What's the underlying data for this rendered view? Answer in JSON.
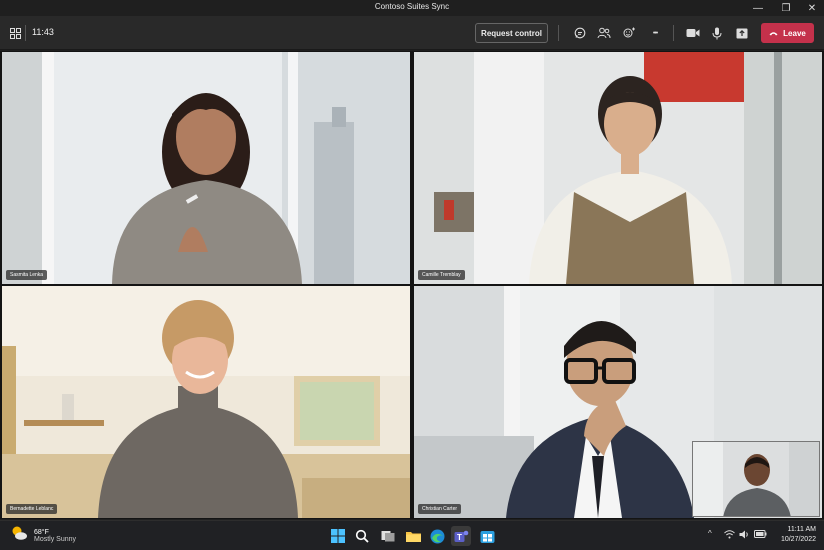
{
  "window": {
    "title": "Contoso Suites Sync",
    "minimize_glyph": "—",
    "restore_glyph": "❐",
    "close_glyph": "✕"
  },
  "toolbar": {
    "time": "11:43",
    "request_control_label": "Request control",
    "leave_label": "Leave",
    "more_glyph": "•••",
    "leave_color": "#c4314b"
  },
  "participants": [
    {
      "name": "Sasmita Lenka"
    },
    {
      "name": "Camille Tremblay"
    },
    {
      "name": "Bernadette Leblanc"
    },
    {
      "name": "Christian Carter"
    }
  ],
  "taskbar": {
    "weather_temp": "68°F",
    "weather_condition": "Mostly Sunny",
    "time": "11:11 AM",
    "date": "10/27/2022",
    "tray_chevron": "^"
  }
}
